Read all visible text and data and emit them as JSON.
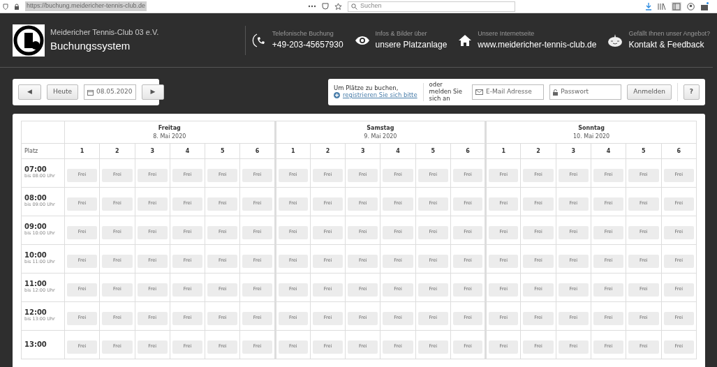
{
  "browser": {
    "url": "https://buchung.meidericher-tennis-club.de",
    "search_placeholder": "Suchen"
  },
  "header": {
    "club": "Meidericher Tennis-Club 03 e.V.",
    "title": "Buchungssystem",
    "infos": [
      {
        "kind": "phone",
        "label": "Telefonische Buchung",
        "value": "+49-203-45657930"
      },
      {
        "kind": "eye",
        "label": "Infos & Bilder über",
        "value": "unsere Platzanlage"
      },
      {
        "kind": "house",
        "label": "Unsere Internetseite",
        "value": "www.meidericher-tennis-club.de"
      },
      {
        "kind": "smiley",
        "label": "Gefällt Ihnen unser Angebot?",
        "value": "Kontakt & Feedback"
      }
    ]
  },
  "nav": {
    "prev": "◀",
    "today": "Heute",
    "date": "08.05.2020",
    "next": "▶"
  },
  "login": {
    "prompt": "Um Plätze zu buchen,",
    "register_link": "registrieren Sie sich bitte",
    "or_text": "oder melden Sie sich an",
    "email_placeholder": "E-Mail Adresse",
    "password_placeholder": "Passwort",
    "submit": "Anmelden",
    "help": "?"
  },
  "table": {
    "corner_label": "Platz",
    "days": [
      {
        "name": "Freitag",
        "date": "8. Mai 2020",
        "courts": [
          "1",
          "2",
          "3",
          "4",
          "5",
          "6"
        ]
      },
      {
        "name": "Samstag",
        "date": "9. Mai 2020",
        "courts": [
          "1",
          "2",
          "3",
          "4",
          "5",
          "6"
        ]
      },
      {
        "name": "Sonntag",
        "date": "10. Mai 2020",
        "courts": [
          "1",
          "2",
          "3",
          "4",
          "5",
          "6"
        ]
      }
    ],
    "rows": [
      {
        "time": "07:00",
        "until": "bis 08:00 Uhr",
        "slots": [
          "Frei",
          "Frei",
          "Frei",
          "Frei",
          "Frei",
          "Frei",
          "Frei",
          "Frei",
          "Frei",
          "Frei",
          "Frei",
          "Frei",
          "Frei",
          "Frei",
          "Frei",
          "Frei",
          "Frei",
          "Frei"
        ]
      },
      {
        "time": "08:00",
        "until": "bis 09:00 Uhr",
        "slots": [
          "Frei",
          "Frei",
          "Frei",
          "Frei",
          "Frei",
          "Frei",
          "Frei",
          "Frei",
          "Frei",
          "Frei",
          "Frei",
          "Frei",
          "Frei",
          "Frei",
          "Frei",
          "Frei",
          "Frei",
          "Frei"
        ]
      },
      {
        "time": "09:00",
        "until": "bis 10:00 Uhr",
        "slots": [
          "Frei",
          "Frei",
          "Frei",
          "Frei",
          "Frei",
          "Frei",
          "Frei",
          "Frei",
          "Frei",
          "Frei",
          "Frei",
          "Frei",
          "Frei",
          "Frei",
          "Frei",
          "Frei",
          "Frei",
          "Frei"
        ]
      },
      {
        "time": "10:00",
        "until": "bis 11:00 Uhr",
        "slots": [
          "Frei",
          "Frei",
          "Frei",
          "Frei",
          "Frei",
          "Frei",
          "Frei",
          "Frei",
          "Frei",
          "Frei",
          "Frei",
          "Frei",
          "Frei",
          "Frei",
          "Frei",
          "Frei",
          "Frei",
          "Frei"
        ]
      },
      {
        "time": "11:00",
        "until": "bis 12:00 Uhr",
        "slots": [
          "Frei",
          "Frei",
          "Frei",
          "Frei",
          "Frei",
          "Frei",
          "Frei",
          "Frei",
          "Frei",
          "Frei",
          "Frei",
          "Frei",
          "Frei",
          "Frei",
          "Frei",
          "Frei",
          "Frei",
          "Frei"
        ]
      },
      {
        "time": "12:00",
        "until": "bis 13:00 Uhr",
        "slots": [
          "Frei",
          "Frei",
          "Frei",
          "Frei",
          "Frei",
          "Frei",
          "Frei",
          "Frei",
          "Frei",
          "Frei",
          "Frei",
          "Frei",
          "Frei",
          "Frei",
          "Frei",
          "Frei",
          "Frei",
          "Frei"
        ]
      },
      {
        "time": "13:00",
        "slots": [
          "Frei",
          "Frei",
          "Frei",
          "Frei",
          "Frei",
          "Frei",
          "Frei",
          "Frei",
          "Frei",
          "Frei",
          "Frei",
          "Frei",
          "Frei",
          "Frei",
          "Frei",
          "Frei",
          "Frei",
          "Frei"
        ]
      }
    ]
  }
}
